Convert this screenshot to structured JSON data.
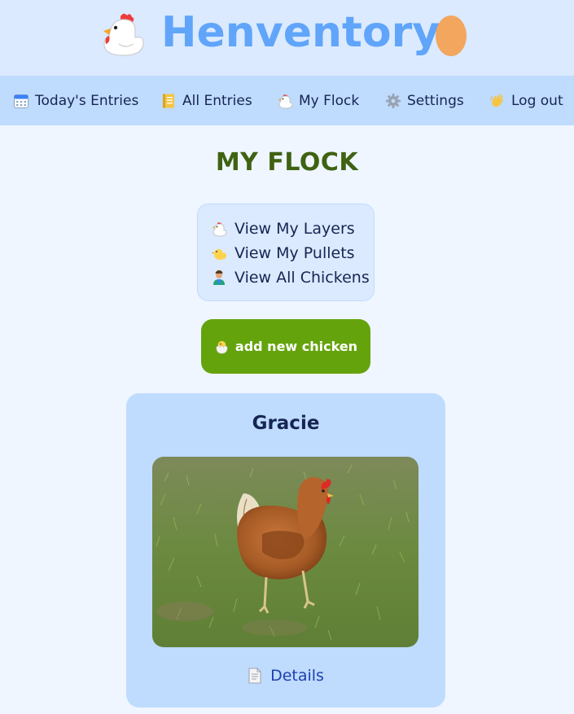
{
  "app": {
    "title": "Henventory"
  },
  "nav": {
    "items": [
      {
        "label": "Today's Entries",
        "icon": "calendar-icon"
      },
      {
        "label": "All Entries",
        "icon": "notebook-icon"
      },
      {
        "label": "My Flock",
        "icon": "chicken-icon"
      },
      {
        "label": "Settings",
        "icon": "gear-icon"
      },
      {
        "label": "Log out",
        "icon": "waving-hand-icon"
      }
    ]
  },
  "page": {
    "title": "MY FLOCK"
  },
  "flock_menu": {
    "links": [
      {
        "label": "View My Layers",
        "icon": "chicken-icon"
      },
      {
        "label": "View My Pullets",
        "icon": "baby-chick-icon"
      },
      {
        "label": "View All Chickens",
        "icon": "farmer-icon"
      }
    ]
  },
  "add_button": {
    "label": "add new chicken",
    "icon": "hatching-chick-icon"
  },
  "chicken_card": {
    "name": "Gracie",
    "details_label": "Details",
    "details_icon": "page-icon"
  },
  "colors": {
    "header_bg": "#dbeafe",
    "nav_bg": "#bfdbfe",
    "page_bg": "#eff6ff",
    "title_blue": "#60a5fa",
    "heading_green": "#3f6212",
    "button_green": "#65a30d",
    "link_blue": "#1e40af"
  }
}
